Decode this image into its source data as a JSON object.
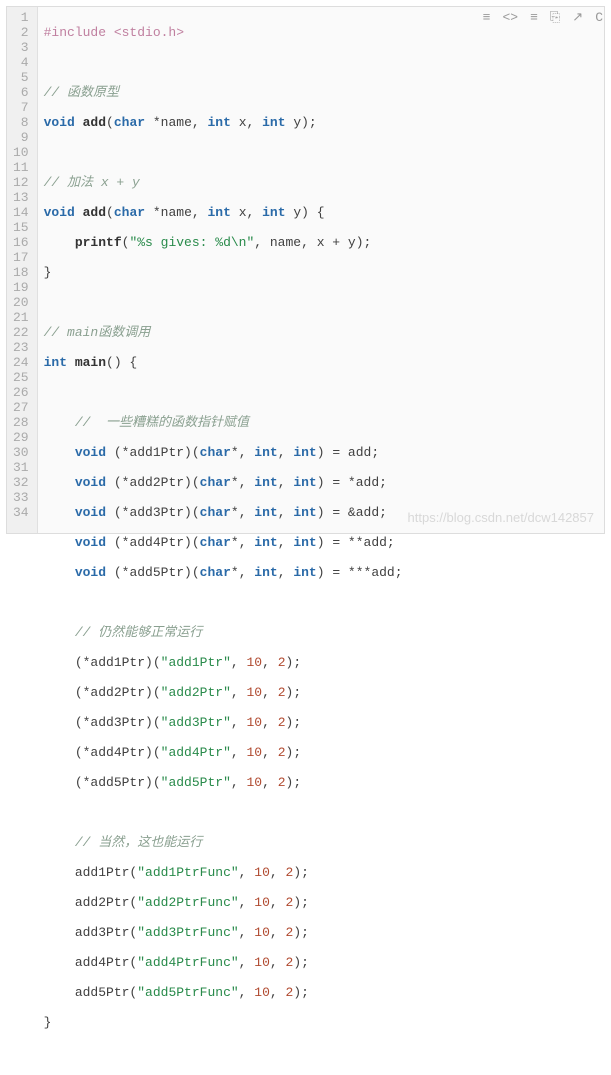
{
  "toolbar": {
    "icon1": "≡",
    "icon2": "<>",
    "icon3": "≡",
    "icon4": "⎘",
    "icon5": "↗",
    "lang": "C"
  },
  "lines": {
    "count": 34
  },
  "code": {
    "l1_pre": "#include <stdio.h>",
    "l3_c": "// 函数原型",
    "l4_void": "void",
    "l4_add": " add",
    "l4_p1": "(",
    "l4_char": "char",
    "l4_name": " *name, ",
    "l4_int1": "int",
    "l4_x": " x, ",
    "l4_int2": "int",
    "l4_y": " y);",
    "l6_c": "// 加法 x + y",
    "l7_void": "void",
    "l7_add": " add",
    "l7_p1": "(",
    "l7_char": "char",
    "l7_name": " *name, ",
    "l7_int1": "int",
    "l7_x": " x, ",
    "l7_int2": "int",
    "l7_y": " y) {",
    "l8_ind": "    ",
    "l8_printf": "printf",
    "l8_p1": "(",
    "l8_str": "\"%s gives: %d\\n\"",
    "l8_rest": ", name, x + y);",
    "l9": "}",
    "l11_c": "// main函数调用",
    "l12_int": "int",
    "l12_main": " main",
    "l12_rest": "() {",
    "l14_c": "    //  一些糟糕的函数指针赋值",
    "l15_ind": "    ",
    "l15_void": "void",
    "l15_p": " (*add1Ptr)(",
    "l15_char": "char",
    "l15_c2": "*, ",
    "l15_int1": "int",
    "l15_c3": ", ",
    "l15_int2": "int",
    "l15_c4": ") = add;",
    "l16_ind": "    ",
    "l16_void": "void",
    "l16_p": " (*add2Ptr)(",
    "l16_char": "char",
    "l16_c2": "*, ",
    "l16_int1": "int",
    "l16_c3": ", ",
    "l16_int2": "int",
    "l16_c4": ") = *add;",
    "l17_ind": "    ",
    "l17_void": "void",
    "l17_p": " (*add3Ptr)(",
    "l17_char": "char",
    "l17_c2": "*, ",
    "l17_int1": "int",
    "l17_c3": ", ",
    "l17_int2": "int",
    "l17_c4": ") = &add;",
    "l18_ind": "    ",
    "l18_void": "void",
    "l18_p": " (*add4Ptr)(",
    "l18_char": "char",
    "l18_c2": "*, ",
    "l18_int1": "int",
    "l18_c3": ", ",
    "l18_int2": "int",
    "l18_c4": ") = **add;",
    "l19_ind": "    ",
    "l19_void": "void",
    "l19_p": " (*add5Ptr)(",
    "l19_char": "char",
    "l19_c2": "*, ",
    "l19_int1": "int",
    "l19_c3": ", ",
    "l19_int2": "int",
    "l19_c4": ") = ***add;",
    "l21_c": "    // 仍然能够正常运行",
    "l22_ind": "    ",
    "l22_a": "(*add1Ptr)(",
    "l22_s": "\"add1Ptr\"",
    "l22_c": ", ",
    "l22_n1": "10",
    "l22_c2": ", ",
    "l22_n2": "2",
    "l22_e": ");",
    "l23_ind": "    ",
    "l23_a": "(*add2Ptr)(",
    "l23_s": "\"add2Ptr\"",
    "l23_c": ", ",
    "l23_n1": "10",
    "l23_c2": ", ",
    "l23_n2": "2",
    "l23_e": ");",
    "l24_ind": "    ",
    "l24_a": "(*add3Ptr)(",
    "l24_s": "\"add3Ptr\"",
    "l24_c": ", ",
    "l24_n1": "10",
    "l24_c2": ", ",
    "l24_n2": "2",
    "l24_e": ");",
    "l25_ind": "    ",
    "l25_a": "(*add4Ptr)(",
    "l25_s": "\"add4Ptr\"",
    "l25_c": ", ",
    "l25_n1": "10",
    "l25_c2": ", ",
    "l25_n2": "2",
    "l25_e": ");",
    "l26_ind": "    ",
    "l26_a": "(*add5Ptr)(",
    "l26_s": "\"add5Ptr\"",
    "l26_c": ", ",
    "l26_n1": "10",
    "l26_c2": ", ",
    "l26_n2": "2",
    "l26_e": ");",
    "l28_c": "    // 当然，这也能运行",
    "l29_ind": "    ",
    "l29_a": "add1Ptr(",
    "l29_s": "\"add1PtrFunc\"",
    "l29_c": ", ",
    "l29_n1": "10",
    "l29_c2": ", ",
    "l29_n2": "2",
    "l29_e": ");",
    "l30_ind": "    ",
    "l30_a": "add2Ptr(",
    "l30_s": "\"add2PtrFunc\"",
    "l30_c": ", ",
    "l30_n1": "10",
    "l30_c2": ", ",
    "l30_n2": "2",
    "l30_e": ");",
    "l31_ind": "    ",
    "l31_a": "add3Ptr(",
    "l31_s": "\"add3PtrFunc\"",
    "l31_c": ", ",
    "l31_n1": "10",
    "l31_c2": ", ",
    "l31_n2": "2",
    "l31_e": ");",
    "l32_ind": "    ",
    "l32_a": "add4Ptr(",
    "l32_s": "\"add4PtrFunc\"",
    "l32_c": ", ",
    "l32_n1": "10",
    "l32_c2": ", ",
    "l32_n2": "2",
    "l32_e": ");",
    "l33_ind": "    ",
    "l33_a": "add5Ptr(",
    "l33_s": "\"add5PtrFunc\"",
    "l33_c": ", ",
    "l33_n1": "10",
    "l33_c2": ", ",
    "l33_n2": "2",
    "l33_e": ");",
    "l34": "}"
  },
  "watermark": "https://blog.csdn.net/dcw142857"
}
